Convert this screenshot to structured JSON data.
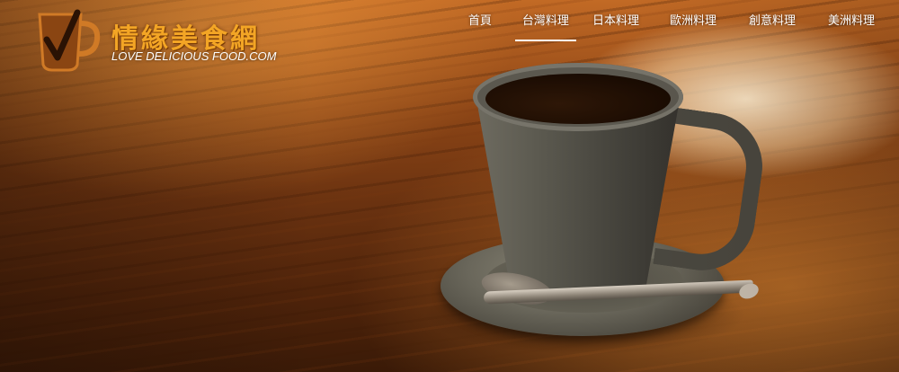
{
  "brand": {
    "title": "情緣美食網",
    "subtitle": "LOVE DELICIOUS FOOD.COM",
    "icon": "coffee-cup-check-icon",
    "title_color": "#f3a525"
  },
  "nav": {
    "active_index": 1,
    "items": [
      {
        "label": "首頁"
      },
      {
        "label": "台灣料理"
      },
      {
        "label": "日本料理"
      },
      {
        "label": "歐洲料理"
      },
      {
        "label": "創意料理"
      },
      {
        "label": "美洲料理"
      }
    ]
  },
  "hero": {
    "image": "coffee-cup-on-wooden-table"
  }
}
